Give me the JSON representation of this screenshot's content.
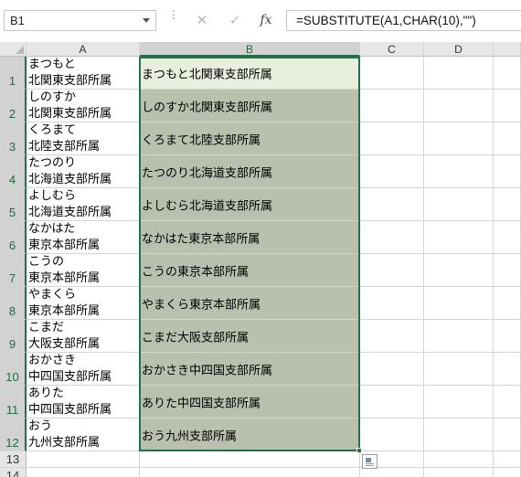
{
  "formula_bar": {
    "name_box": "B1",
    "formula": "=SUBSTITUTE(A1,CHAR(10),\"\")",
    "cancel_icon": "✕",
    "enter_icon": "✓",
    "fx_label": "fx",
    "more_icon": "⋮"
  },
  "columns": [
    "A",
    "B",
    "C",
    "D"
  ],
  "rows": [
    "1",
    "2",
    "3",
    "4",
    "5",
    "6",
    "7",
    "8",
    "9",
    "10",
    "11",
    "12",
    "13",
    "14"
  ],
  "colA": [
    "まつもと\n北関東支部所属",
    "しのすか\n北関東支部所属",
    "くろまて\n北陸支部所属",
    "たつのり\n北海道支部所属",
    "よしむら\n北海道支部所属",
    "なかはた\n東京本部所属",
    "こうの\n東京本部所属",
    "やまくら\n東京本部所属",
    "こまだ\n大阪支部所属",
    "おかさき\n中四国支部所属",
    "ありた\n中四国支部所属",
    "おう\n九州支部所属"
  ],
  "colB": [
    "まつもと北関東支部所属",
    "しのすか北関東支部所属",
    "くろまて北陸支部所属",
    "たつのり北海道支部所属",
    "よしむら北海道支部所属",
    "なかはた東京本部所属",
    "こうの東京本部所属",
    "やまくら東京本部所属",
    "こまだ大阪支部所属",
    "おかさき中四国支部所属",
    "ありた中四国支部所属",
    "おう九州支部所属"
  ],
  "colors": {
    "selection_border": "#217346",
    "selection_fill": "#b9c0ae",
    "active_fill": "#e8efdf"
  }
}
